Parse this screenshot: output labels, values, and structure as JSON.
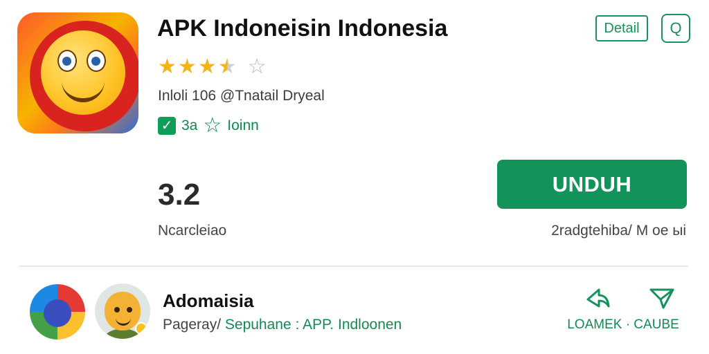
{
  "app": {
    "title": "APK Indoneisin Indonesia",
    "rating_stars": 3.5,
    "max_stars": 5,
    "meta_line": "Inloli 106 @Tnatail Dryeal",
    "badge_count": "3a",
    "badge_label": "Ioinn",
    "rating_value": "3.2",
    "rating_caption": "Ncarcleiao"
  },
  "header_actions": {
    "detail_label": "Detail",
    "chat_icon_glyph": "Q"
  },
  "download": {
    "label": "UNDUH",
    "caption": "2radgtehiba/ M oe ыi"
  },
  "publisher": {
    "name": "Adomaisia",
    "line_prefix": "Pageray/ ",
    "line_link": "Sepuhane : APP. Indloonen",
    "actions_label": "LOAMEK · CAUBE"
  },
  "colors": {
    "accent_green": "#12935a",
    "star_yellow": "#f5b31a",
    "text_dark": "#111111"
  },
  "icons": [
    "app-logo-icon",
    "check-icon",
    "star-outline-icon",
    "chat-icon",
    "share-icon",
    "send-icon"
  ]
}
